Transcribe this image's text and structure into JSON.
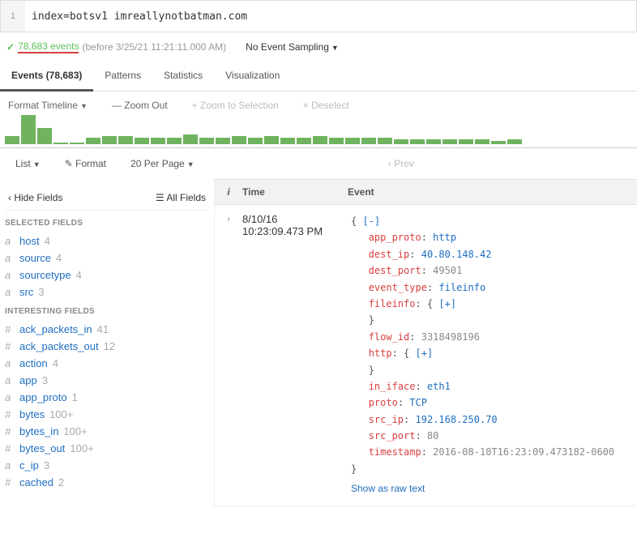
{
  "search": {
    "line": "1",
    "query": "index=botsv1 imreallynotbatman.com"
  },
  "status": {
    "count": "78,683 events",
    "before": "(before 3/25/21 11:21:11.000 AM)",
    "sampling": "No Event Sampling"
  },
  "tabs": {
    "events": "Events (78,683)",
    "patterns": "Patterns",
    "statistics": "Statistics",
    "visualization": "Visualization"
  },
  "tl_ctl": {
    "format": "Format Timeline",
    "zoomout": "Zoom Out",
    "zoomsel": "Zoom to Selection",
    "deselect": "Deselect"
  },
  "list_ctl": {
    "list": "List",
    "format": "Format",
    "perpage": "20 Per Page",
    "prev": "Prev"
  },
  "thead": {
    "i": "i",
    "time": "Time",
    "event": "Event"
  },
  "fields_hdr": {
    "hide": "Hide Fields",
    "all": "All Fields"
  },
  "sections": {
    "selected": "SELECTED FIELDS",
    "interesting": "INTERESTING FIELDS"
  },
  "selected": {
    "host": {
      "t": "a",
      "n": "host",
      "c": "4"
    },
    "source": {
      "t": "a",
      "n": "source",
      "c": "4"
    },
    "sourcetype": {
      "t": "a",
      "n": "sourcetype",
      "c": "4"
    },
    "src": {
      "t": "a",
      "n": "src",
      "c": "3"
    }
  },
  "interesting": {
    "ack_packets_in": {
      "t": "#",
      "n": "ack_packets_in",
      "c": "41"
    },
    "ack_packets_out": {
      "t": "#",
      "n": "ack_packets_out",
      "c": "12"
    },
    "action": {
      "t": "a",
      "n": "action",
      "c": "4"
    },
    "app": {
      "t": "a",
      "n": "app",
      "c": "3"
    },
    "app_proto": {
      "t": "a",
      "n": "app_proto",
      "c": "1"
    },
    "bytes": {
      "t": "#",
      "n": "bytes",
      "c": "100+"
    },
    "bytes_in": {
      "t": "#",
      "n": "bytes_in",
      "c": "100+"
    },
    "bytes_out": {
      "t": "#",
      "n": "bytes_out",
      "c": "100+"
    },
    "c_ip": {
      "t": "a",
      "n": "c_ip",
      "c": "3"
    },
    "cached": {
      "t": "#",
      "n": "cached",
      "c": "2"
    }
  },
  "event0": {
    "date": "8/10/16",
    "time": "10:23:09.473 PM",
    "app_proto": "http",
    "dest_ip": "40.80.148.42",
    "dest_port": "49501",
    "event_type": "fileinfo",
    "fileinfo_label": "fileinfo",
    "flow_id": "3318498196",
    "http_label": "http",
    "in_iface": "eth1",
    "proto": "TCP",
    "src_ip": "192.168.250.70",
    "src_port": "80",
    "timestamp": "2016-08-10T16:23:09.473182-0600",
    "raw": "Show as raw text"
  },
  "chart_data": {
    "type": "bar",
    "categories": [
      "b1",
      "b2",
      "b3",
      "b4",
      "b5",
      "b6",
      "b7",
      "b8",
      "b9",
      "b10",
      "b11",
      "b12",
      "b13",
      "b14",
      "b15",
      "b16",
      "b17",
      "b18",
      "b19",
      "b20",
      "b21",
      "b22",
      "b23",
      "b24",
      "b25",
      "b26",
      "b27",
      "b28",
      "b29",
      "b30",
      "b31",
      "b32"
    ],
    "values": [
      10,
      36,
      20,
      2,
      2,
      8,
      10,
      10,
      8,
      8,
      8,
      12,
      8,
      8,
      10,
      8,
      10,
      8,
      8,
      10,
      8,
      8,
      8,
      8,
      6,
      6,
      6,
      6,
      6,
      6,
      4,
      6
    ],
    "title": "",
    "xlabel": "",
    "ylabel": "",
    "ylim": [
      0,
      40
    ]
  }
}
